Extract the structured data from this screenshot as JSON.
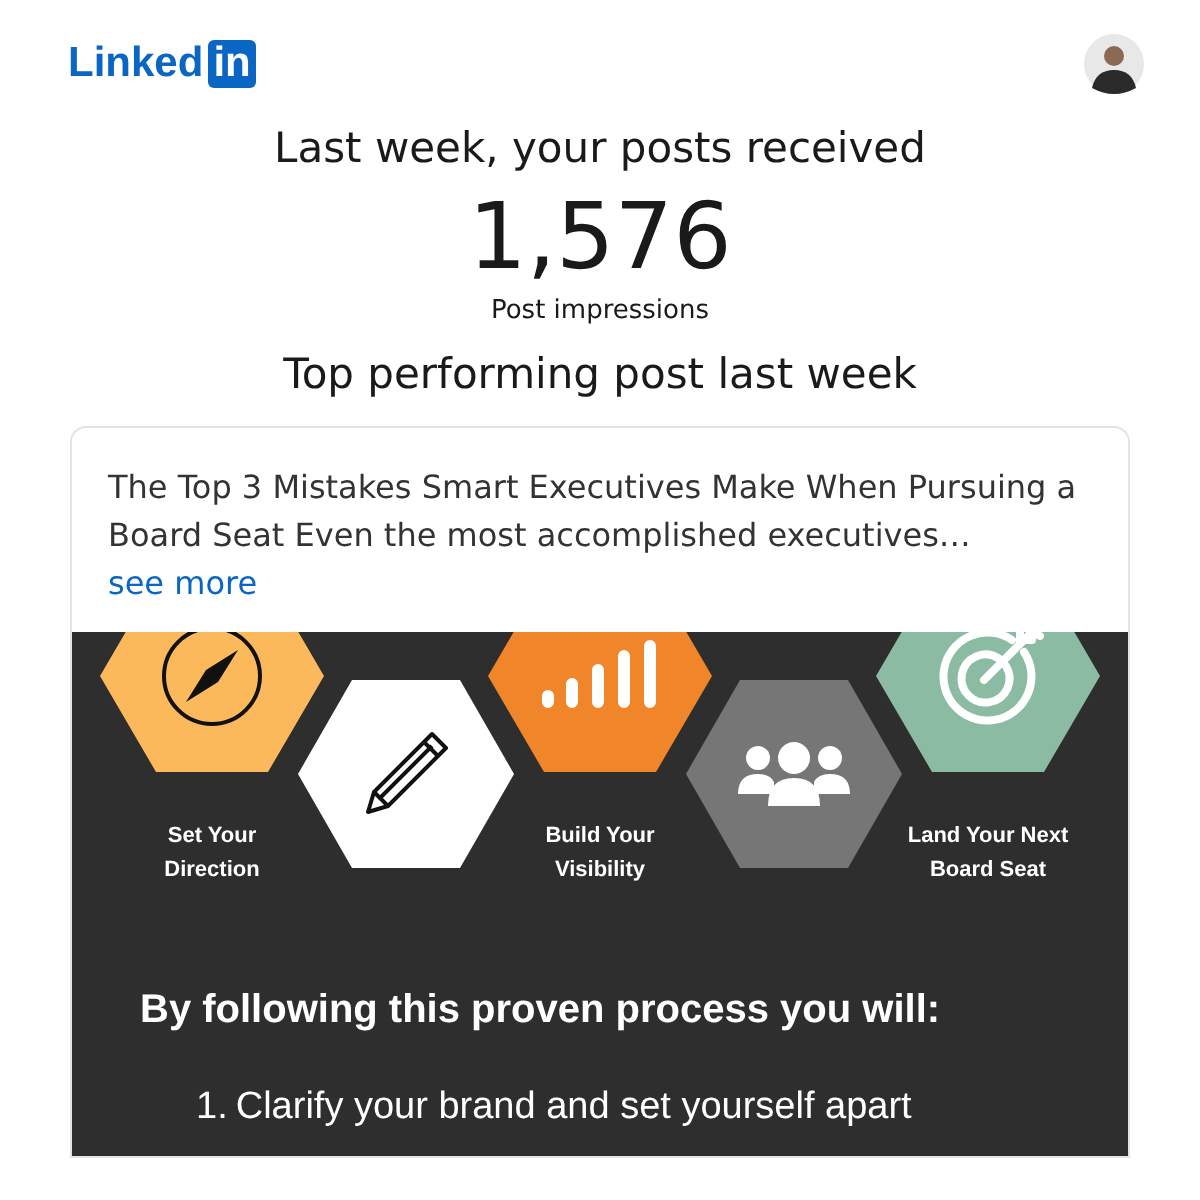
{
  "header": {
    "logo_text": "Linked",
    "logo_badge": "in"
  },
  "headline": "Last week, your posts received",
  "impressions": "1,576",
  "impressions_label": "Post impressions",
  "section_title": "Top performing post last week",
  "post": {
    "text": "The Top 3 Mistakes Smart Executives Make When Pursuing a Board Seat Even the most accomplished executives…",
    "see_more": "see more",
    "infographic": {
      "steps": [
        {
          "kind": "compass",
          "color": "#fbb95b",
          "label": "Set Your\nDirection"
        },
        {
          "kind": "pencil",
          "color": "#ffffff"
        },
        {
          "kind": "bars",
          "color": "#f0852a",
          "label": "Build Your\nVisibility"
        },
        {
          "kind": "people",
          "color": "#767676"
        },
        {
          "kind": "target",
          "color": "#8cbba3",
          "label": "Land Your Next\nBoard Seat"
        }
      ],
      "heading": "By following this proven process you will:",
      "list": [
        {
          "number": "1.",
          "text": "Clarify your brand and set yourself apart"
        }
      ]
    }
  }
}
